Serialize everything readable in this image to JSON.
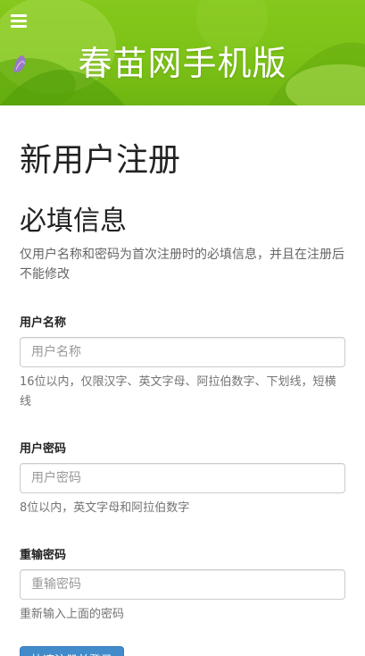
{
  "header": {
    "site_title": "春苗网手机版",
    "menu_icon": "hamburger-menu-icon",
    "background_color": "#7cc217"
  },
  "main": {
    "page_title": "新用户注册",
    "section_title": "必填信息",
    "section_desc": "仅用户名称和密码为首次注册时的必填信息，并且在注册后不能修改",
    "fields": [
      {
        "label": "用户名称",
        "placeholder": "用户名称",
        "value": "",
        "help": "16位以内，仅限汉字、英文字母、阿拉伯数字、下划线，短横线"
      },
      {
        "label": "用户密码",
        "placeholder": "用户密码",
        "value": "",
        "help": "8位以内，英文字母和阿拉伯数字"
      },
      {
        "label": "重输密码",
        "placeholder": "重输密码",
        "value": "",
        "help": "重新输入上面的密码"
      }
    ],
    "submit_label": "快速注册并登录",
    "accent_color": "#428bca"
  }
}
